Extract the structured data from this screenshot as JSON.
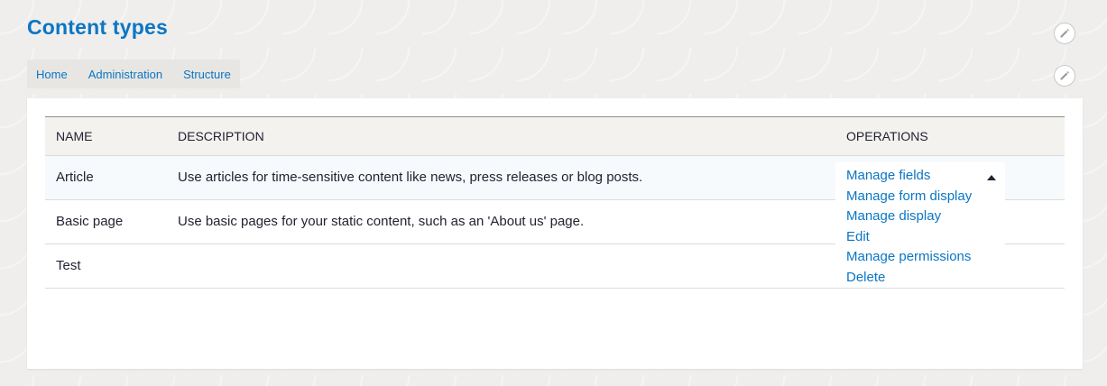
{
  "page": {
    "title": "Content types"
  },
  "breadcrumb": {
    "items": [
      "Home",
      "Administration",
      "Structure"
    ]
  },
  "icons": {
    "edit": "pencil-icon"
  },
  "table": {
    "headers": {
      "name": "NAME",
      "description": "DESCRIPTION",
      "operations": "OPERATIONS"
    },
    "rows": [
      {
        "name": "Article",
        "description": "Use articles for time-sensitive content like news, press releases or blog posts."
      },
      {
        "name": "Basic page",
        "description": "Use basic pages for your static content, such as an 'About us' page."
      },
      {
        "name": "Test",
        "description": ""
      }
    ]
  },
  "operations": {
    "items": [
      "Manage fields",
      "Manage form display",
      "Manage display",
      "Edit",
      "Manage permissions",
      "Delete"
    ]
  },
  "colors": {
    "accent": "#0b76c4",
    "text": "#222330"
  }
}
